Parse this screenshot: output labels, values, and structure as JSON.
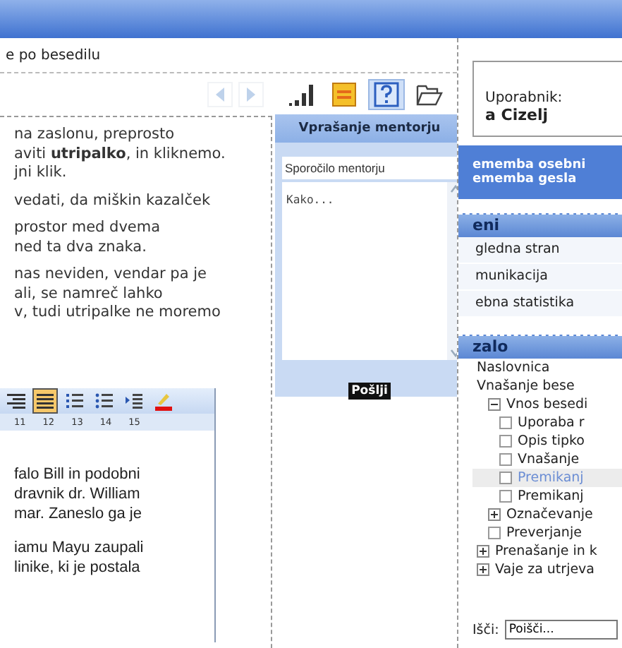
{
  "breadcrumb": "e po besedilu",
  "nav_buttons": [
    {
      "kind": "back",
      "disabled": true
    },
    {
      "kind": "forward",
      "disabled": true
    }
  ],
  "tools": [
    {
      "kind": "chart",
      "selected": false
    },
    {
      "kind": "notes",
      "selected": false
    },
    {
      "kind": "help",
      "selected": true
    },
    {
      "kind": "open",
      "selected": false
    }
  ],
  "paragraphs": [
    [
      "na zaslonu, preprosto",
      "aviti **utripalko**, in kliknemo.",
      "jni klik."
    ],
    [
      "vedati, da miškin kazalček"
    ],
    [
      "prostor med dvema",
      "ned ta dva znaka."
    ],
    [
      "nas neviden, vendar pa je",
      "ali, se namreč lahko",
      "v, tudi utripalke ne moremo"
    ]
  ],
  "word_screenshot": {
    "toolbar": [
      {
        "kind": "align-right",
        "selected": false
      },
      {
        "kind": "justify",
        "selected": true
      },
      {
        "kind": "numbering",
        "selected": false
      },
      {
        "kind": "bullets",
        "selected": false
      },
      {
        "kind": "indent",
        "selected": false
      },
      {
        "kind": "highlight",
        "selected": false
      }
    ],
    "ruler": [
      "11",
      "12",
      "13",
      "14",
      "15"
    ],
    "paragraphs": [
      [
        "falo Bill in podobni",
        "dravnik dr. William",
        "mar. Zaneslo ga je"
      ],
      [
        "iamu Mayu zaupali",
        "linike, ki je postala"
      ]
    ]
  },
  "mentor_dialog": {
    "title": "Vprašanje mentorju",
    "subject": {
      "value": "Sporočilo mentorju"
    },
    "message": {
      "value": "Kako..."
    },
    "send_button": "Pošlji"
  },
  "user_box": {
    "label": "Uporabnik:",
    "name": "a Cizelj"
  },
  "account_links": [
    "ememba osebni",
    "ememba gesla"
  ],
  "menu": {
    "title": "eni",
    "items": [
      "gledna stran",
      "munikacija",
      "ebna statistika"
    ]
  },
  "contents": {
    "title": "zalo",
    "tree": [
      {
        "kind": "plain",
        "label": "Naslovnica",
        "selected": false
      },
      {
        "kind": "plain",
        "label": "Vnašanje bese",
        "selected": false,
        "children": [
          {
            "kind": "folder",
            "label": "Vnos besedi",
            "expanded": true,
            "selected": false,
            "children": [
              {
                "kind": "page",
                "label": "Uporaba r",
                "selected": false
              },
              {
                "kind": "page",
                "label": "Opis tipko",
                "selected": false
              },
              {
                "kind": "page",
                "label": "Vnašanje",
                "selected": false
              },
              {
                "kind": "page",
                "label": "Premikanj",
                "selected": true
              },
              {
                "kind": "page",
                "label": "Premikanj",
                "selected": false
              }
            ]
          },
          {
            "kind": "folder",
            "label": "Označevanje",
            "expanded": false,
            "selected": false
          },
          {
            "kind": "page",
            "label": "Preverjanje",
            "selected": false
          }
        ]
      },
      {
        "kind": "folder",
        "label": "Prenašanje in k",
        "expanded": false,
        "selected": false
      },
      {
        "kind": "folder",
        "label": "Vaje za utrjeva",
        "expanded": false,
        "selected": false
      }
    ]
  },
  "search": {
    "label": "Išči:",
    "value": "Poišči..."
  }
}
